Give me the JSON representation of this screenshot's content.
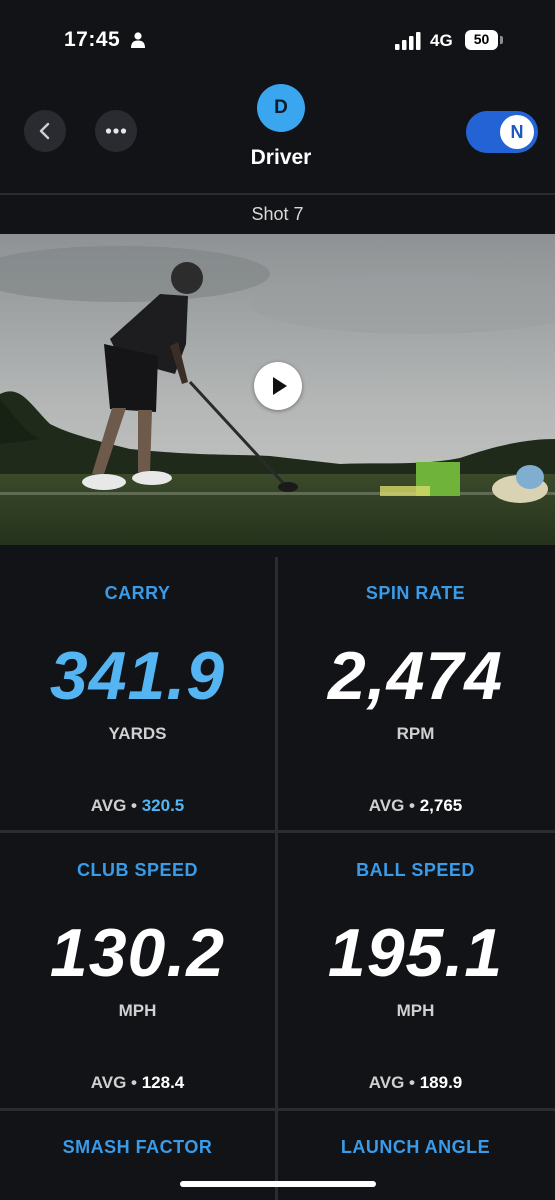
{
  "status_bar": {
    "time": "17:45",
    "network": "4G",
    "battery": "50",
    "icons": [
      "person-icon",
      "signal-icon",
      "battery-icon"
    ]
  },
  "header": {
    "club_initial": "D",
    "club_name": "Driver",
    "unit_toggle": "N",
    "icons": [
      "back-icon",
      "more-icon"
    ]
  },
  "shot": {
    "label": "Shot 7"
  },
  "video": {
    "icon": "play-icon"
  },
  "stats": [
    {
      "label": "CARRY",
      "value": "341.9",
      "unit": "YARDS",
      "avg_prefix": "AVG •",
      "avg_value": "320.5",
      "accent": true
    },
    {
      "label": "SPIN RATE",
      "value": "2,474",
      "unit": "RPM",
      "avg_prefix": "AVG •",
      "avg_value": "2,765",
      "accent": false
    },
    {
      "label": "CLUB SPEED",
      "value": "130.2",
      "unit": "MPH",
      "avg_prefix": "AVG •",
      "avg_value": "128.4",
      "accent": false
    },
    {
      "label": "BALL SPEED",
      "value": "195.1",
      "unit": "MPH",
      "avg_prefix": "AVG •",
      "avg_value": "189.9",
      "accent": false
    },
    {
      "label": "SMASH FACTOR"
    },
    {
      "label": "LAUNCH ANGLE"
    }
  ],
  "colors": {
    "background": "#121316",
    "accent_blue": "#3a9be8",
    "highlight_value": "#55b5f3",
    "toggle_blue": "#2363d6",
    "avatar_blue": "#3aa6ef"
  }
}
